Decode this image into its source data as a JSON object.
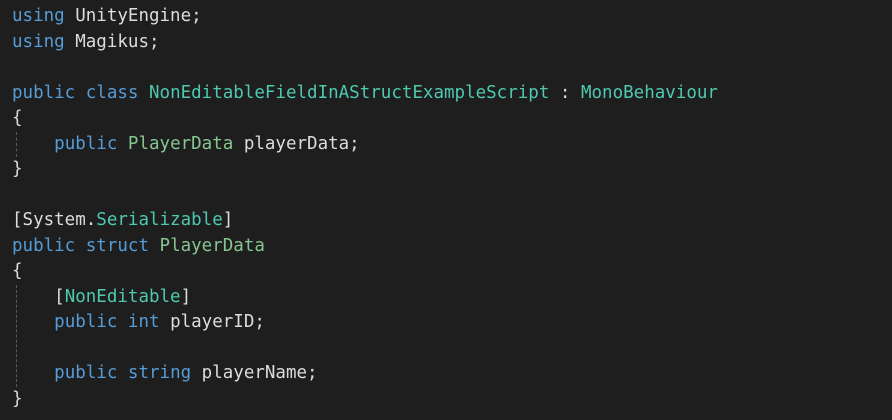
{
  "colors": {
    "background": "#1e1e1e",
    "keyword": "#569cd6",
    "class_type": "#4ec9b0",
    "struct_type": "#86c691",
    "plain_text": "#dcdcdc",
    "indent_guide": "#5a5a5a"
  },
  "code": {
    "lines": [
      [
        {
          "text": "using",
          "kind": "kw"
        },
        {
          "text": " UnityEngine;",
          "kind": "plain"
        }
      ],
      [
        {
          "text": "using",
          "kind": "kw"
        },
        {
          "text": " Magikus;",
          "kind": "plain"
        }
      ],
      [],
      [
        {
          "text": "public",
          "kind": "kw"
        },
        {
          "text": " ",
          "kind": "plain"
        },
        {
          "text": "class",
          "kind": "kw"
        },
        {
          "text": " ",
          "kind": "plain"
        },
        {
          "text": "NonEditableFieldInAStructExampleScript",
          "kind": "type"
        },
        {
          "text": " : ",
          "kind": "plain"
        },
        {
          "text": "MonoBehaviour",
          "kind": "type"
        }
      ],
      [
        {
          "text": "{",
          "kind": "plain"
        }
      ],
      [
        {
          "text": "    ",
          "kind": "plain"
        },
        {
          "text": "public",
          "kind": "kw"
        },
        {
          "text": " ",
          "kind": "plain"
        },
        {
          "text": "PlayerData",
          "kind": "struct"
        },
        {
          "text": " playerData;",
          "kind": "plain"
        }
      ],
      [
        {
          "text": "}",
          "kind": "plain"
        }
      ],
      [],
      [
        {
          "text": "[System.",
          "kind": "plain"
        },
        {
          "text": "Serializable",
          "kind": "type"
        },
        {
          "text": "]",
          "kind": "plain"
        }
      ],
      [
        {
          "text": "public",
          "kind": "kw"
        },
        {
          "text": " ",
          "kind": "plain"
        },
        {
          "text": "struct",
          "kind": "kw"
        },
        {
          "text": " ",
          "kind": "plain"
        },
        {
          "text": "PlayerData",
          "kind": "struct"
        }
      ],
      [
        {
          "text": "{",
          "kind": "plain"
        }
      ],
      [
        {
          "text": "    [",
          "kind": "plain"
        },
        {
          "text": "NonEditable",
          "kind": "type"
        },
        {
          "text": "]",
          "kind": "plain"
        }
      ],
      [
        {
          "text": "    ",
          "kind": "plain"
        },
        {
          "text": "public",
          "kind": "kw"
        },
        {
          "text": " ",
          "kind": "plain"
        },
        {
          "text": "int",
          "kind": "kw"
        },
        {
          "text": " playerID;",
          "kind": "plain"
        }
      ],
      [],
      [
        {
          "text": "    ",
          "kind": "plain"
        },
        {
          "text": "public",
          "kind": "kw"
        },
        {
          "text": " ",
          "kind": "plain"
        },
        {
          "text": "string",
          "kind": "kw"
        },
        {
          "text": " playerName;",
          "kind": "plain"
        }
      ],
      [
        {
          "text": "}",
          "kind": "plain"
        }
      ]
    ]
  }
}
